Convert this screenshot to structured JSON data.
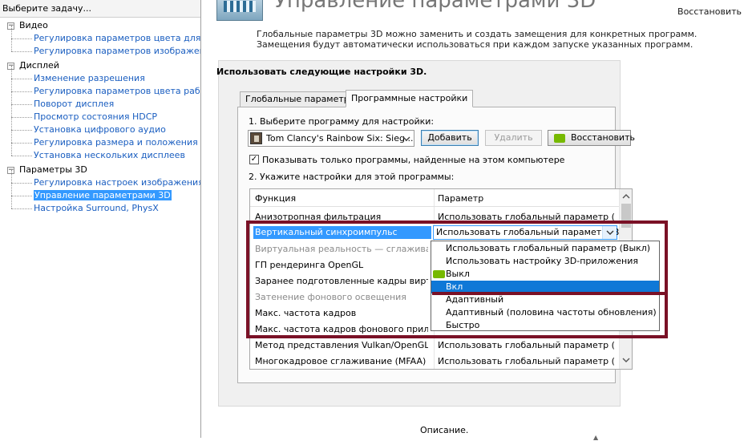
{
  "sidebar": {
    "title": "Выберите задачу...",
    "expander_symbol": "−",
    "categories": [
      {
        "label": "Видео",
        "items": [
          {
            "label": "Регулировка параметров цвета для вид"
          },
          {
            "label": "Регулировка параметров изображения д"
          }
        ]
      },
      {
        "label": "Дисплей",
        "items": [
          {
            "label": "Изменение разрешения"
          },
          {
            "label": "Регулировка параметров цвета рабочег"
          },
          {
            "label": "Поворот дисплея"
          },
          {
            "label": "Просмотр состояния HDCP"
          },
          {
            "label": "Установка цифрового аудио"
          },
          {
            "label": "Регулировка размера и положения рабо"
          },
          {
            "label": "Установка нескольких дисплеев"
          }
        ]
      },
      {
        "label": "Параметры 3D",
        "items": [
          {
            "label": "Регулировка настроек изображения с пр"
          },
          {
            "label": "Управление параметрами 3D",
            "selected": true
          },
          {
            "label": "Настройка Surround, PhysX"
          }
        ]
      }
    ]
  },
  "header": {
    "title": "Управление параметрами 3D",
    "restore_link": "Восстановить",
    "description": "Глобальные параметры 3D можно заменить и создать замещения для конкретных программ. Замещения будут автоматически использоваться при каждом запуске указанных программ."
  },
  "settings": {
    "heading": "Использовать следующие настройки 3D.",
    "tabs": [
      "Глобальные параметры",
      "Программные настройки"
    ],
    "active_tab": 1,
    "step1_label": "1. Выберите программу для настройки:",
    "program_selected": "Tom Clancy's Rainbow Six: Sieg...",
    "add_button": "Добавить",
    "delete_button": "Удалить",
    "restore_button": "Восстановить",
    "checkbox_checked": true,
    "checkbox_mark": "✓",
    "checkbox_label": "Показывать только программы, найденные на этом компьютере",
    "step2_label": "2. Укажите настройки для этой программы:",
    "table": {
      "columns": [
        "Функция",
        "Параметр"
      ],
      "rows": [
        {
          "function": "Анизотропная фильтрация",
          "value": "Использовать глобальный параметр (В...",
          "state": "normal"
        },
        {
          "function": "Вертикальный синхроимпульс",
          "value": "Использовать глобальный параметр (Вы",
          "state": "selected"
        },
        {
          "function": "Виртуальная реальность — сглаживан...",
          "value": "",
          "state": "disabled"
        },
        {
          "function": "ГП рендеринга OpenGL",
          "value": "",
          "state": "normal"
        },
        {
          "function": "Заранее подготовленные кадры вирту...",
          "value": "",
          "state": "normal"
        },
        {
          "function": "Затенение фонового освещения",
          "value": "",
          "state": "disabled"
        },
        {
          "function": "Макс. частота кадров",
          "value": "",
          "state": "normal"
        },
        {
          "function": "Макс. частота кадров фонового прило...",
          "value": "",
          "state": "normal"
        },
        {
          "function": "Метод представления Vulkan/OpenGL",
          "value": "Использовать глобальный параметр (А...",
          "state": "normal"
        },
        {
          "function": "Многокадровое сглаживание (MFAA)",
          "value": "Использовать глобальный параметр (Вы",
          "state": "normal"
        }
      ]
    },
    "dropdown_options": [
      {
        "label": "Использовать глобальный параметр (Выкл)"
      },
      {
        "label": "Использовать настройку 3D-приложения"
      },
      {
        "label": "Выкл",
        "nvidia_icon": true
      },
      {
        "label": "Вкл",
        "highlighted": true
      },
      {
        "label": "Адаптивный"
      },
      {
        "label": "Адаптивный (половина частоты обновления)"
      },
      {
        "label": "Быстро"
      }
    ]
  },
  "footer": {
    "description_label": "Описание.",
    "caret_symbol": "▲"
  },
  "colors": {
    "selection": "#3399ff",
    "dropdown_highlight": "#0f78d7",
    "annotation_frame": "#7a1126",
    "nvidia_green": "#76b900"
  }
}
